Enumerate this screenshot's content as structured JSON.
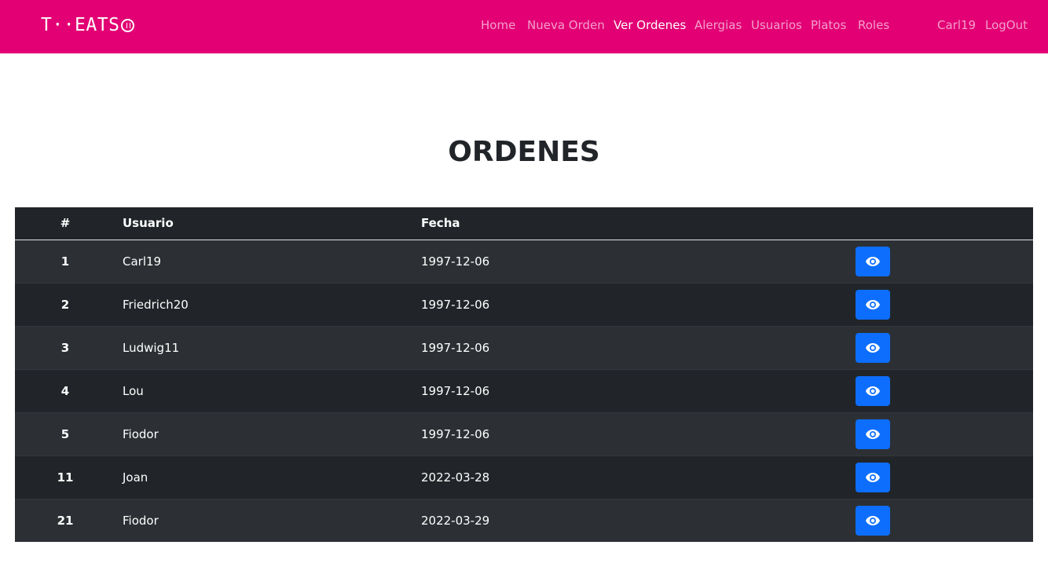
{
  "navbar": {
    "brand": "T··EATS",
    "links": [
      {
        "label": "Home",
        "active": false
      },
      {
        "label": "Nueva Orden",
        "active": false
      },
      {
        "label": "Ver Ordenes",
        "active": true
      },
      {
        "label": "Alergias",
        "active": false
      },
      {
        "label": "Usuarios",
        "active": false
      },
      {
        "label": "Platos",
        "active": false
      },
      {
        "label": "Roles",
        "active": false
      }
    ],
    "user": "Carl19",
    "logout": "LogOut",
    "color": "#e20074"
  },
  "page": {
    "title": "ORDENES"
  },
  "table": {
    "headers": [
      "#",
      "Usuario",
      "Fecha",
      ""
    ],
    "rows": [
      {
        "id": "1",
        "user": "Carl19",
        "date": "1997-12-06",
        "action_icon": "eye-icon"
      },
      {
        "id": "2",
        "user": "Friedrich20",
        "date": "1997-12-06",
        "action_icon": "eye-icon"
      },
      {
        "id": "3",
        "user": "Ludwig11",
        "date": "1997-12-06",
        "action_icon": "eye-icon"
      },
      {
        "id": "4",
        "user": "Lou",
        "date": "1997-12-06",
        "action_icon": "eye-icon"
      },
      {
        "id": "5",
        "user": "Fiodor",
        "date": "1997-12-06",
        "action_icon": "eye-icon"
      },
      {
        "id": "11",
        "user": "Joan",
        "date": "2022-03-28",
        "action_icon": "eye-icon"
      },
      {
        "id": "21",
        "user": "Fiodor",
        "date": "2022-03-29",
        "action_icon": "eye-icon"
      }
    ],
    "button_color": "#0d6efd"
  }
}
